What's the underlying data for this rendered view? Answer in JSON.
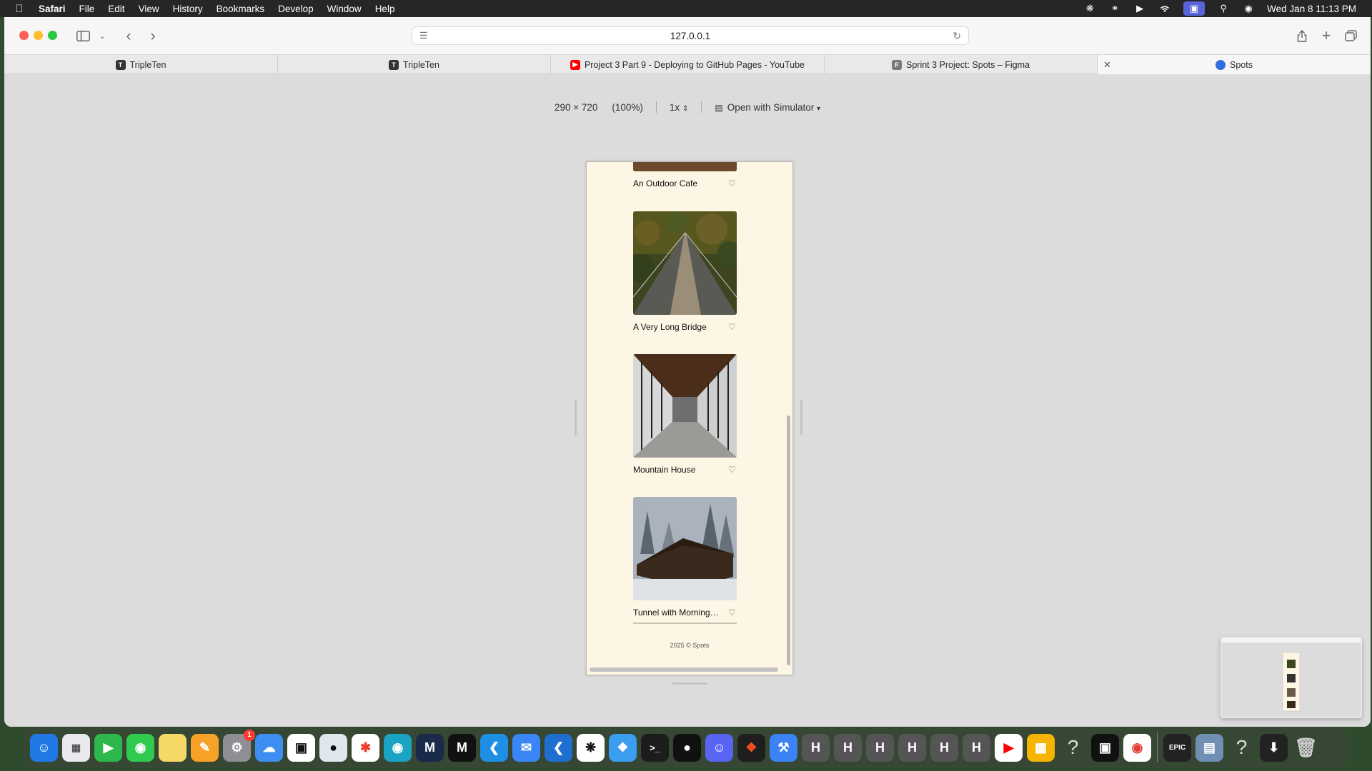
{
  "menubar": {
    "app_name": "Safari",
    "items": [
      "File",
      "Edit",
      "View",
      "History",
      "Bookmarks",
      "Develop",
      "Window",
      "Help"
    ],
    "clock": "Wed Jan 8  11:13 PM"
  },
  "toolbar": {
    "url": "127.0.0.1"
  },
  "tabs": [
    {
      "label": "TripleTen"
    },
    {
      "label": "TripleTen"
    },
    {
      "label": "Project 3 Part 9 - Deploying to GitHub Pages - YouTube"
    },
    {
      "label": "Sprint 3 Project: Spots – Figma"
    },
    {
      "label": "Spots"
    }
  ],
  "responsive_bar": {
    "dimensions": "290 × 720",
    "zoom": "(100%)",
    "scale": "1x",
    "simulator": "Open with Simulator"
  },
  "page": {
    "cards": [
      {
        "title": "An Outdoor Cafe"
      },
      {
        "title": "A Very Long Bridge"
      },
      {
        "title": "Mountain House"
      },
      {
        "title": "Tunnel with Morning…"
      }
    ],
    "footer": "2025 © Spots"
  },
  "dock": {
    "settings_badge": "1",
    "letter_apps": [
      "H",
      "H",
      "H",
      "H",
      "H",
      "H"
    ],
    "epic_label": "EPIC"
  }
}
